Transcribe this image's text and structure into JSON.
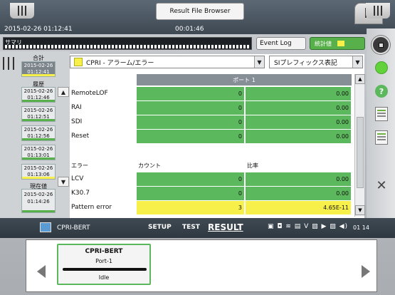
{
  "header": {
    "title": "Result File Browser",
    "datetime": "2015-02-26 01:12:41",
    "elapsed": "00:01:46",
    "summary_label": "サマリ",
    "event_log": "Event Log",
    "stats": "統計値"
  },
  "selectors": {
    "protocol": "CPRI - アラーム/エラー",
    "format": "SIプレフィックス表記"
  },
  "timeline": {
    "total_label": "合計",
    "total_time": "2015-02-26\n01:12:41",
    "history_label": "履歴",
    "current_label": "現在値",
    "items": [
      {
        "date": "2015-02-26",
        "time": "01:12:46"
      },
      {
        "date": "2015-02-26",
        "time": "01:12:51"
      },
      {
        "date": "2015-02-26",
        "time": "01:12:56"
      },
      {
        "date": "2015-02-26",
        "time": "01:13:01"
      },
      {
        "date": "2015-02-26",
        "time": "01:13:06"
      },
      {
        "date": "2015-02-26",
        "time": "01:14:26"
      }
    ]
  },
  "table": {
    "port_header": "ポート 1",
    "alarms": [
      {
        "name": "RemoteLOF",
        "count": "0",
        "rate": "0.00"
      },
      {
        "name": "RAI",
        "count": "0",
        "rate": "0.00"
      },
      {
        "name": "SDI",
        "count": "0",
        "rate": "0.00"
      },
      {
        "name": "Reset",
        "count": "0",
        "rate": "0.00"
      }
    ],
    "error_header": {
      "name": "エラー",
      "count": "カウント",
      "rate": "比率"
    },
    "errors": [
      {
        "name": "LCV",
        "count": "0",
        "rate": "0.00"
      },
      {
        "name": "K30.7",
        "count": "0",
        "rate": "0.00"
      },
      {
        "name": "Pattern error",
        "count": "3",
        "rate": "4.65E-11"
      }
    ]
  },
  "bottombar": {
    "app_name": "CPRI-BERT",
    "tab_setup": "SETUP",
    "tab_test": "TEST",
    "tab_result": "RESULT",
    "status_icons": "▣ ◘ ≋ ▤ V ▧ ▶ ▨ ◀)",
    "clock": "01 14"
  },
  "port_card": {
    "title": "CPRI-BERT",
    "port": "Port-1",
    "state": "Idle"
  },
  "colors": {
    "ok_green": "#5cb85c",
    "warn_yellow": "#f7ef4a",
    "header_gray": "#868e96"
  }
}
